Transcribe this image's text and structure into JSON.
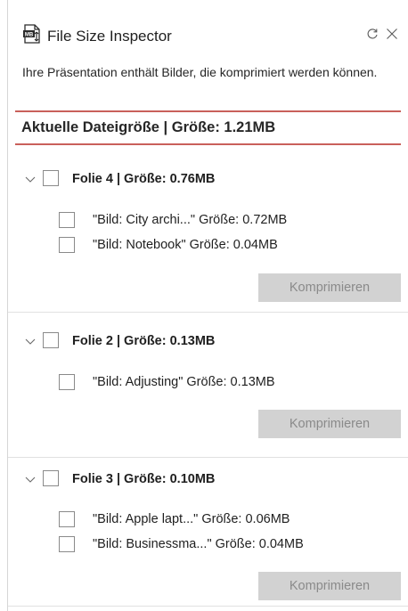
{
  "header": {
    "title": "File Size Inspector",
    "icon_badge": "MB"
  },
  "message": "Ihre Präsentation enthält Bilder, die komprimiert werden können.",
  "current_size": "Aktuelle Dateigröße | Größe: 1.21MB",
  "accent_color": "#c9605b",
  "compress_label": "Komprimieren",
  "slides": [
    {
      "label": "Folie 4 | Größe: 0.76MB",
      "images": [
        "\"Bild: City archi...\" Größe: 0.72MB",
        "\"Bild: Notebook\" Größe: 0.04MB"
      ]
    },
    {
      "label": "Folie 2 | Größe: 0.13MB",
      "images": [
        "\"Bild: Adjusting\" Größe: 0.13MB"
      ]
    },
    {
      "label": "Folie 3 | Größe: 0.10MB",
      "images": [
        "\"Bild: Apple lapt...\" Größe: 0.06MB",
        "\"Bild: Businessma...\" Größe: 0.04MB"
      ]
    }
  ]
}
